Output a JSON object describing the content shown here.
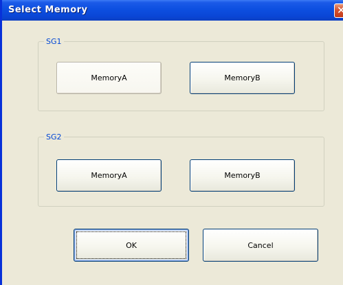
{
  "window": {
    "title": "Select Memory",
    "close_label": "✕"
  },
  "sg1": {
    "legend": "SG1",
    "memory_a_label": "MemoryA",
    "memory_b_label": "MemoryB"
  },
  "sg2": {
    "legend": "SG2",
    "memory_a_label": "MemoryA",
    "memory_b_label": "MemoryB"
  },
  "footer": {
    "ok_label": "OK",
    "cancel_label": "Cancel"
  },
  "colors": {
    "titlebar": "#0d4fe0",
    "dialog_bg": "#ece9d8",
    "legend_text": "#0046d5",
    "close_button": "#d5522f"
  }
}
